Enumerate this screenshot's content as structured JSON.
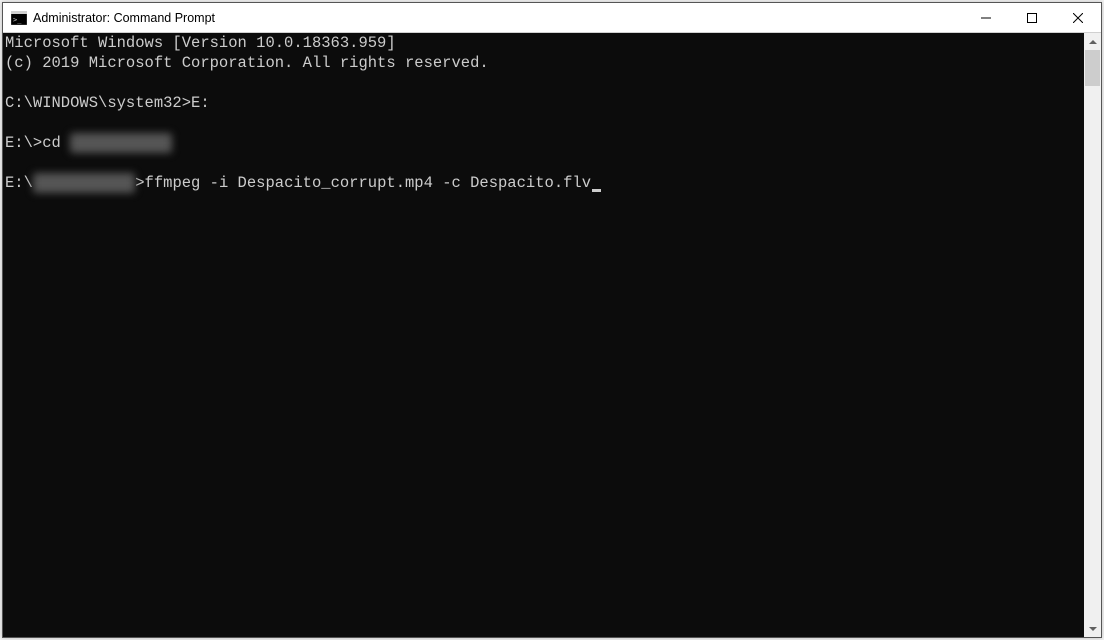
{
  "window": {
    "title": "Administrator: Command Prompt"
  },
  "terminal": {
    "line1": "Microsoft Windows [Version 10.0.18363.959]",
    "line2": "(c) 2019 Microsoft Corporation. All rights reserved.",
    "line3_prompt": "C:\\WINDOWS\\system32>",
    "line3_cmd": "E:",
    "line4_prompt": "E:\\>",
    "line4_cmd_pre": "cd ",
    "line4_blurred": "Video Songs",
    "line5_prompt_pre": "E:\\",
    "line5_blurred": "Video Songs",
    "line5_prompt_post": ">",
    "line5_cmd": "ffmpeg -i Despacito_corrupt.mp4 -c Despacito.flv"
  }
}
